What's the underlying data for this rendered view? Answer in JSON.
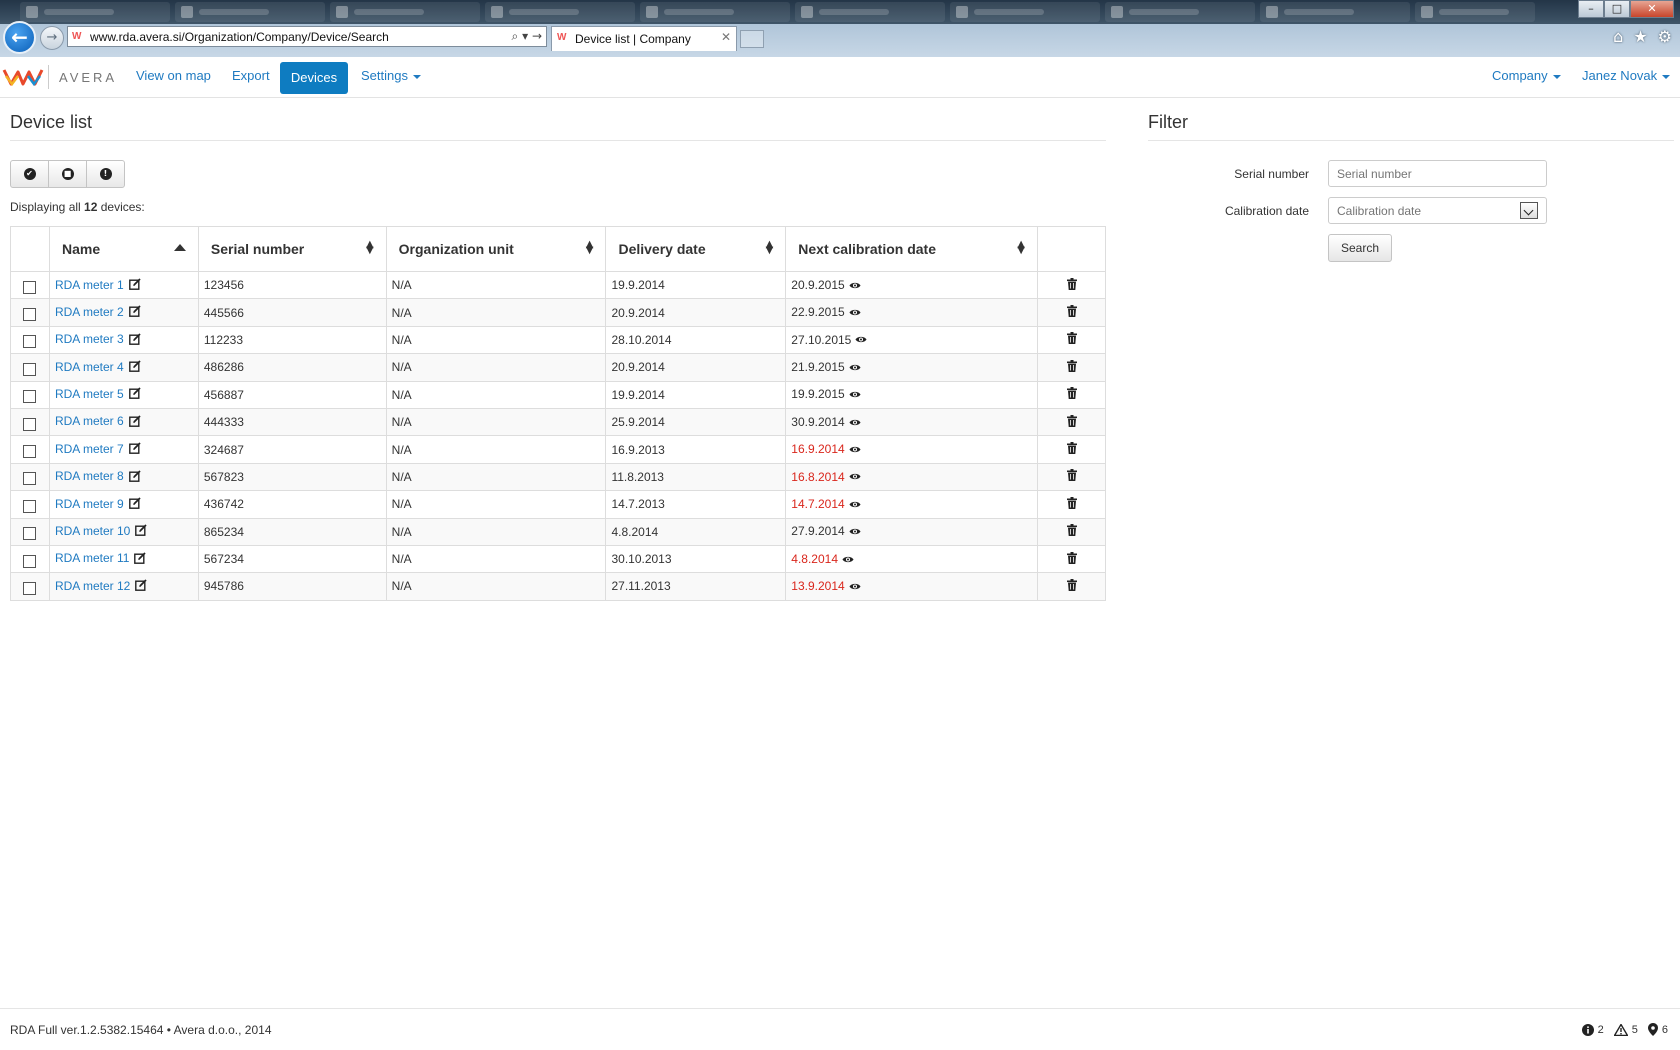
{
  "browser": {
    "url": "www.rda.avera.si/Organization/Company/Device/Search",
    "tab_title": "Device list | Company",
    "window_controls": [
      "–",
      "□",
      "✕"
    ]
  },
  "nav": {
    "brand": "AVERA",
    "links": [
      "View on map",
      "Export",
      "Devices",
      "Settings"
    ],
    "company": "Company",
    "user": "Janez Novak"
  },
  "device_list": {
    "heading": "Device list",
    "count_prefix": "Displaying all ",
    "count": "12",
    "count_suffix": " devices:",
    "columns": [
      "Name",
      "Serial number",
      "Organization unit",
      "Delivery date",
      "Next calibration date"
    ],
    "rows": [
      {
        "name": "RDA meter 1",
        "serial": "123456",
        "org": "N/A",
        "delivery": "19.9.2014",
        "calibration": "20.9.2015",
        "overdue": false
      },
      {
        "name": "RDA meter 2",
        "serial": "445566",
        "org": "N/A",
        "delivery": "20.9.2014",
        "calibration": "22.9.2015",
        "overdue": false
      },
      {
        "name": "RDA meter 3",
        "serial": "112233",
        "org": "N/A",
        "delivery": "28.10.2014",
        "calibration": "27.10.2015",
        "overdue": false
      },
      {
        "name": "RDA meter 4",
        "serial": "486286",
        "org": "N/A",
        "delivery": "20.9.2014",
        "calibration": "21.9.2015",
        "overdue": false
      },
      {
        "name": "RDA meter 5",
        "serial": "456887",
        "org": "N/A",
        "delivery": "19.9.2014",
        "calibration": "19.9.2015",
        "overdue": false
      },
      {
        "name": "RDA meter 6",
        "serial": "444333",
        "org": "N/A",
        "delivery": "25.9.2014",
        "calibration": "30.9.2014",
        "overdue": false
      },
      {
        "name": "RDA meter 7",
        "serial": "324687",
        "org": "N/A",
        "delivery": "16.9.2013",
        "calibration": "16.9.2014",
        "overdue": true
      },
      {
        "name": "RDA meter 8",
        "serial": "567823",
        "org": "N/A",
        "delivery": "11.8.2013",
        "calibration": "16.8.2014",
        "overdue": true
      },
      {
        "name": "RDA meter 9",
        "serial": "436742",
        "org": "N/A",
        "delivery": "14.7.2013",
        "calibration": "14.7.2014",
        "overdue": true
      },
      {
        "name": "RDA meter 10",
        "serial": "865234",
        "org": "N/A",
        "delivery": "4.8.2014",
        "calibration": "27.9.2014",
        "overdue": false
      },
      {
        "name": "RDA meter 11",
        "serial": "567234",
        "org": "N/A",
        "delivery": "30.10.2013",
        "calibration": "4.8.2014",
        "overdue": true
      },
      {
        "name": "RDA meter 12",
        "serial": "945786",
        "org": "N/A",
        "delivery": "27.11.2013",
        "calibration": "13.9.2014",
        "overdue": true
      }
    ]
  },
  "filter": {
    "heading": "Filter",
    "serial_label": "Serial number",
    "serial_placeholder": "Serial number",
    "calibration_label": "Calibration date",
    "calibration_placeholder": "Calibration date",
    "search_label": "Search"
  },
  "footer": {
    "version": "RDA Full ver.1.2.5382.15464 • Avera d.o.o., 2014",
    "info_count": "2",
    "warning_count": "5",
    "location_count": "6"
  },
  "colors": {
    "accent": "#0e7cc1",
    "link": "#1f7ac1",
    "overdue": "#d9261c"
  }
}
